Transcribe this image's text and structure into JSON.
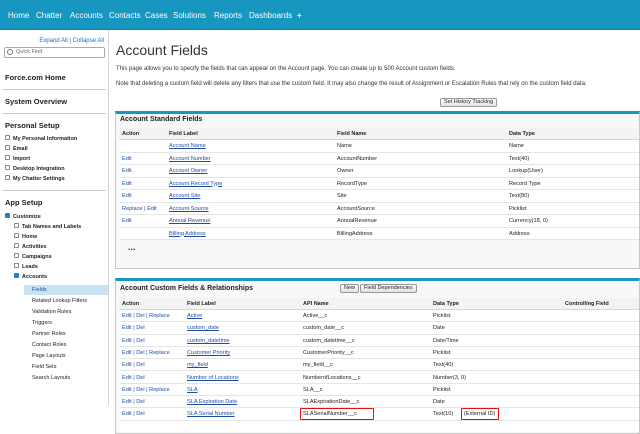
{
  "nav": {
    "tabs": [
      "Home",
      "Chatter",
      "Accounts",
      "Contacts",
      "Cases",
      "Solutions",
      "Reports",
      "Dashboards",
      "+"
    ]
  },
  "sidebar": {
    "expand_collapse": "Expand All | Collapse All",
    "quick_find_placeholder": "Quick Find",
    "force_home": "Force.com Home",
    "system_overview": "System Overview",
    "personal_setup": {
      "title": "Personal Setup",
      "items": [
        "My Personal Information",
        "Email",
        "Import",
        "Desktop Integration",
        "My Chatter Settings"
      ]
    },
    "app_setup": {
      "title": "App Setup",
      "customize": "Customize",
      "customize_items": [
        "Tab Names and Labels",
        "Home",
        "Activities",
        "Campaigns",
        "Leads"
      ],
      "accounts": "Accounts",
      "accounts_items": [
        "Fields",
        "Related Lookup Filters",
        "Validation Rules",
        "Triggers",
        "Partner Roles",
        "Contact Roles",
        "Page Layouts",
        "Field Sets",
        "Search Layouts"
      ]
    }
  },
  "page": {
    "title": "Account Fields",
    "desc1": "This page allows you to specify the fields that can appear on the Account page. You can create up to 500 Account custom fields.",
    "desc2": "Note that deleting a custom field will delete any filters that use the custom field. It may also change the result of Assignment or Escalation Rules that rely on the custom field data.",
    "history_button": "Set History Tracking"
  },
  "standard": {
    "title": "Account Standard Fields",
    "headers": [
      "Action",
      "Field Label",
      "Field Name",
      "Data Type"
    ],
    "rows": [
      {
        "action": "",
        "label": "Account Name",
        "name": "Name",
        "type": "Name"
      },
      {
        "action": "Edit",
        "label": "Account Number",
        "name": "AccountNumber",
        "type": "Text(40)"
      },
      {
        "action": "Edit",
        "label": "Account Owner",
        "name": "Owner",
        "type": "Lookup(User)"
      },
      {
        "action": "Edit",
        "label": "Account Record Type",
        "name": "RecordType",
        "type": "Record Type"
      },
      {
        "action": "Edit",
        "label": "Account Site",
        "name": "Site",
        "type": "Text(80)"
      },
      {
        "action": "Replace | Edit",
        "label": "Account Source",
        "name": "AccountSource",
        "type": "Picklist"
      },
      {
        "action": "Edit",
        "label": "Annual Revenue",
        "name": "AnnualRevenue",
        "type": "Currency(18, 0)"
      },
      {
        "action": "",
        "label": "Billing Address",
        "name": "BillingAddress",
        "type": "Address"
      }
    ],
    "ellipsis": "..."
  },
  "custom": {
    "title": "Account Custom Fields & Relationships",
    "new_button": "New",
    "deps_button": "Field Dependencies",
    "headers": [
      "Action",
      "Field Label",
      "API Name",
      "Data Type",
      "Controlling Field"
    ],
    "rows": [
      {
        "action": "Edit | Del | Replace",
        "label": "Active",
        "api": "Active__c",
        "type": "Picklist",
        "extra": ""
      },
      {
        "action": "Edit | Del",
        "label": "custom_date",
        "api": "custom_date__c",
        "type": "Date",
        "extra": ""
      },
      {
        "action": "Edit | Del",
        "label": "custom_datetime",
        "api": "custom_datetime__c",
        "type": "Date/Time",
        "extra": ""
      },
      {
        "action": "Edit | Del | Replace",
        "label": "Customer Priority",
        "api": "CustomerPriority__c",
        "type": "Picklist",
        "extra": ""
      },
      {
        "action": "Edit | Del",
        "label": "my_field",
        "api": "my_field__c",
        "type": "Text(40)",
        "extra": ""
      },
      {
        "action": "Edit | Del",
        "label": "Number of Locations",
        "api": "NumberofLocations__c",
        "type": "Number(3, 0)",
        "extra": ""
      },
      {
        "action": "Edit | Del | Replace",
        "label": "SLA",
        "api": "SLA__c",
        "type": "Picklist",
        "extra": ""
      },
      {
        "action": "Edit | Del",
        "label": "SLA Expiration Date",
        "api": "SLAExpirationDate__c",
        "type": "Date",
        "extra": ""
      },
      {
        "action": "Edit | Del",
        "label": "SLA Serial Number",
        "api": "SLASerialNumber__c",
        "type": "Text(10)",
        "extra": "(External ID)"
      }
    ]
  },
  "colors": {
    "nav": "#1797c0",
    "highlight": "#dd1111",
    "link": "#1e4ea3"
  }
}
